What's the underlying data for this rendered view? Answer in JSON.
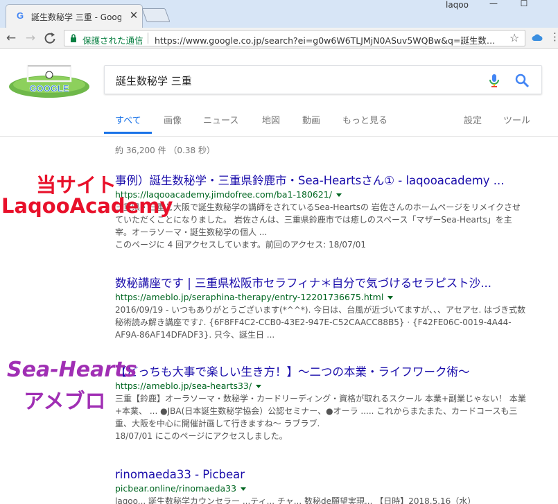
{
  "browser": {
    "tab_title": "誕生数秘学 三重 - Googl",
    "tab_close": "✕",
    "tab_favicon": "G",
    "user_name": "laqoo",
    "window_minimize": "—",
    "window_maximize": "☐",
    "nav_back": "←",
    "nav_forward": "→",
    "nav_reload": "C",
    "secure_label": "保護された通信",
    "url": "https://www.google.co.jp/search?ei=g0w6W6TLJMjN0ASuv5WQBw&q=誕生数…",
    "star": "☆",
    "menu": "⋮"
  },
  "search": {
    "query": "誕生数秘学 三重",
    "doodle_text": "GOOGLE"
  },
  "tabs": [
    {
      "label": "すべて"
    },
    {
      "label": "画像"
    },
    {
      "label": "ニュース"
    },
    {
      "label": "地図"
    },
    {
      "label": "動画"
    },
    {
      "label": "もっと見る"
    },
    {
      "label": "設定"
    },
    {
      "label": "ツール"
    }
  ],
  "stats": "約 36,200 件 （0.38 秒）",
  "results": [
    {
      "title": "事例）誕生数秘学・三重県鈴鹿市・Sea-Heartsさん① - laqooacademy ...",
      "url": "https://laqooacademy.jimdofree.com/ba1-180621/",
      "snippet": "三重県・三重と大阪で誕生数秘学の講師をされているSea-Heartsの 岩佐さんのホームページをリメイクさせていただくことになりました。 岩佐さんは、三重県鈴鹿市では癒しのスペース「マザーSea-Hearts」を主宰。オーラソーマ・誕生数秘学の個人 ...",
      "visit": "このページに 4 回アクセスしています。前回のアクセス: 18/07/01"
    },
    {
      "title": "数秘講座です | 三重県松阪市セラフィナ＊自分で気づけるセラピスト沙...",
      "url": "https://ameblo.jp/seraphina-therapy/entry-12201736675.html",
      "snippet": "2016/09/19 - いつもありがとうございます(*^^*). 今日は、台風が近づいてますが、、、アセアセ. はづき式数秘術読み解き講座です♪. {6F8FF4C2-CCB0-43E2-947E-C52CAACC88B5} · {F42FE06C-0019-4A44-AF9A-86AF14DFADF3}. 只今、誕生日 ..."
    },
    {
      "title": "【どっちも大事で楽しい生き方！】〜二つの本業・ライフワーク術〜",
      "url": "https://ameblo.jp/sea-hearts33/",
      "snippet": "三重【鈴鹿】オーラソーマ・数秘学・カードリーディング・資格が取れるスクール 本業+副業じゃない！ 本業+本業、 ... ●JBA(日本誕生数秘学協会）公認セミナー、●オーラ ..... これからまたまた、カードコースも三重、大阪を中心に開催計画して行きますね〜 ラブラブ.",
      "visit": "18/07/01 にこのページにアクセスしました。"
    },
    {
      "title": "rinomaeda33 - Picbear",
      "url": "picbear.online/rinomaeda33",
      "snippet": "laqoo... 誕生数秘学カウンセラー ...ティ... チャ... 数秘de願望実現... 【日時】2018.5.16（水）"
    }
  ],
  "annotations": {
    "site_line1": "当サイト",
    "site_line2": "LaqooAcademy",
    "blog_line1": "Sea-Hearts",
    "blog_line2": "アメブロ"
  },
  "colors": {
    "link": "#1a0dab",
    "url_green": "#006621",
    "active_tab": "#1a73e8",
    "annotation_red": "#e8102a",
    "annotation_purple": "#a02fb4"
  }
}
